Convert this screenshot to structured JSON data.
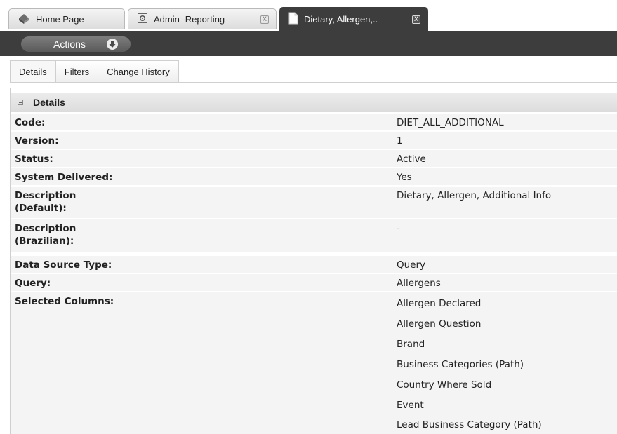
{
  "tabs": [
    {
      "label": "Home Page"
    },
    {
      "label": "Admin -Reporting",
      "close": "X"
    },
    {
      "label": "Dietary, Allergen,..",
      "close": "X"
    }
  ],
  "actions": {
    "label": "Actions"
  },
  "subtabs": [
    "Details",
    "Filters",
    "Change History"
  ],
  "details": {
    "title": "Details",
    "code": {
      "label": "Code:",
      "value": "DIET_ALL_ADDITIONAL"
    },
    "version": {
      "label": "Version:",
      "value": "1"
    },
    "status": {
      "label": "Status:",
      "value": "Active"
    },
    "system_delivered": {
      "label": "System Delivered:",
      "value": "Yes"
    },
    "desc_default": {
      "label1": "Description",
      "label2": "(Default):",
      "value": "Dietary, Allergen, Additional Info"
    },
    "desc_brazilian": {
      "label1": "Description",
      "label2": "(Brazilian):",
      "value": "-"
    },
    "data_source_type": {
      "label": "Data Source Type:",
      "value": "Query"
    },
    "query": {
      "label": "Query:",
      "value": "Allergens"
    },
    "selected_columns": {
      "label": "Selected Columns:",
      "items": [
        "Allergen Declared",
        "Allergen Question",
        "Brand",
        "Business Categories (Path)",
        "Country Where Sold",
        "Event",
        "Lead Business Category (Path)"
      ]
    }
  }
}
